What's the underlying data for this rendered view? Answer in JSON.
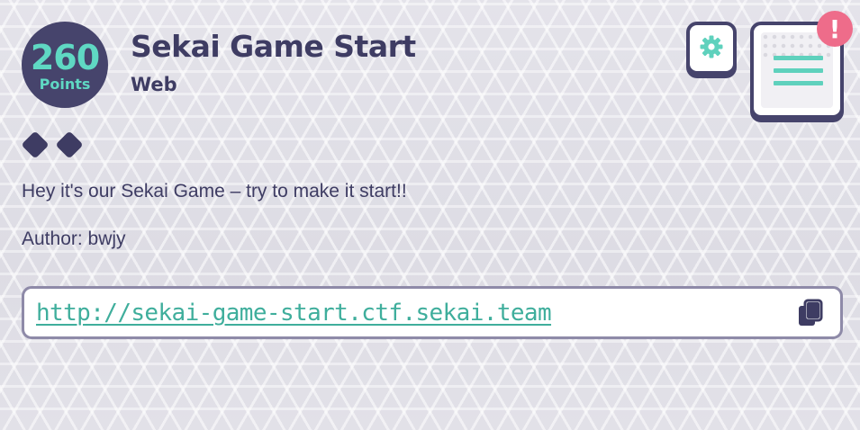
{
  "challenge": {
    "points": "260",
    "points_label": "Points",
    "title": "Sekai Game Start",
    "category": "Web",
    "difficulty": 2,
    "description": "Hey it's our Sekai Game – try to make it start!!",
    "author": "Author: bwjy",
    "url": "http://sekai-game-start.ctf.sekai.team"
  },
  "notifications": {
    "alert_symbol": "!"
  },
  "icons": {
    "settings": "gear-icon",
    "notes": "notes-icon",
    "copy": "copy-icon",
    "difficulty": "diamond-icon"
  },
  "colors": {
    "accent_teal": "#5fd8c3",
    "dark_navy": "#3e3c63",
    "link_green": "#3fae9c",
    "alert_pink": "#ee6c8a"
  }
}
